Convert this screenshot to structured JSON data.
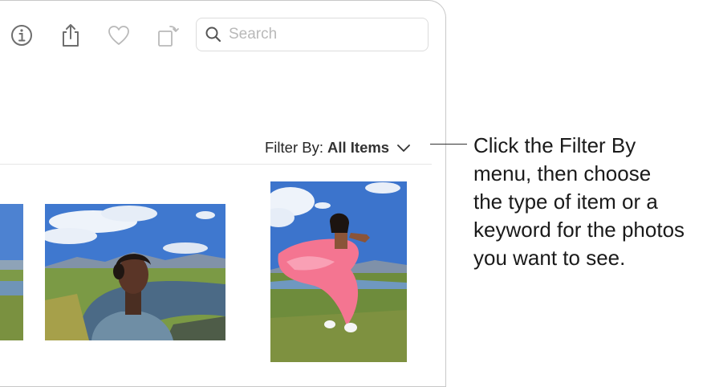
{
  "toolbar": {
    "buttons": [
      {
        "name": "info-button",
        "icon": "info-icon"
      },
      {
        "name": "share-button",
        "icon": "share-icon"
      },
      {
        "name": "favorite-button",
        "icon": "heart-icon"
      },
      {
        "name": "rotate-button",
        "icon": "rotate-icon"
      }
    ],
    "search": {
      "placeholder": "Search",
      "value": "",
      "icon": "search-icon"
    }
  },
  "filter": {
    "label": "Filter By:",
    "value": "All Items",
    "icon": "chevron-down-icon"
  },
  "photos": [
    {
      "description": "partial photo of sky, mountains and river",
      "icon": "photo-thumbnail"
    },
    {
      "description": "man in blue shirt looking up beside a creek",
      "icon": "photo-thumbnail"
    },
    {
      "description": "woman in flowing pink dress in a meadow",
      "icon": "photo-thumbnail"
    }
  ],
  "callout": {
    "text": "Click the Filter By\nmenu, then choose\nthe type of item or a\nkeyword for the photos\nyou want to see."
  },
  "colors": {
    "border": "#c8c8c8",
    "icon": "#6e6e6e",
    "sky": "#3d74c9",
    "grass": "#6a8a3a",
    "pink": "#f26a8d"
  }
}
